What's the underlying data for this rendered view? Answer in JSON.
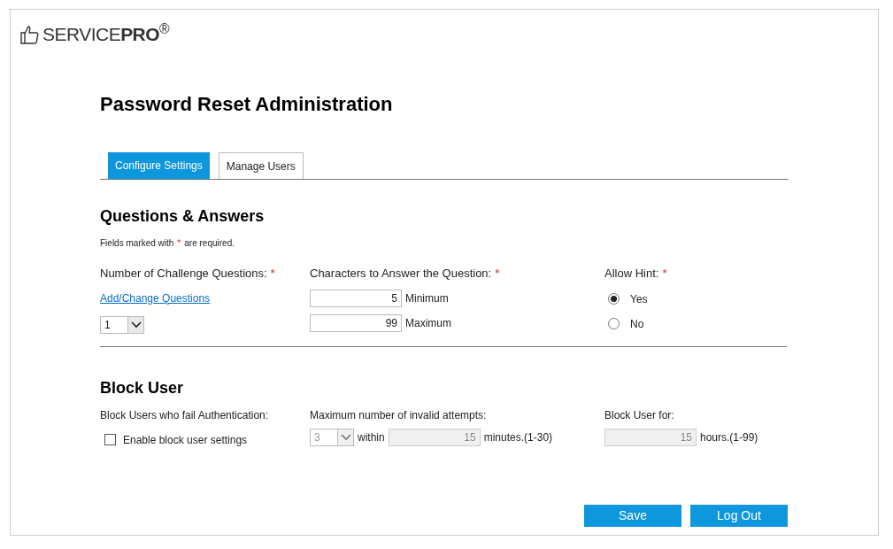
{
  "brand": {
    "text": "SERVICE**PRO**$^{®}$"
  },
  "title": "Password Reset Administration",
  "tabs": [
    {
      "label": "Configure Settings",
      "selected": true
    },
    {
      "label": "Manage Users",
      "selected": false
    }
  ],
  "questions": {
    "heading": "Questions & Answers",
    "note": {
      "before": "Fields marked with",
      "mark": "*",
      "after": "are required."
    },
    "count_label": {
      "text": "Number of Challenge Questions:",
      "mark": "*"
    },
    "link": "Add/Change Questions",
    "count_select": {
      "value": "1",
      "disabled": false
    },
    "chars_label": {
      "text": "Characters to Answer the Question:",
      "mark": "*"
    },
    "chars": [
      {
        "value": "5",
        "unit": "Minimum"
      },
      {
        "value": "99",
        "unit": "Maximum"
      }
    ],
    "hint_label": {
      "text": "Allow Hint:",
      "mark": "*"
    },
    "hint_options": [
      {
        "label": "Yes",
        "selected": true
      },
      {
        "label": "No",
        "selected": false
      }
    ]
  },
  "block": {
    "heading": "Block User",
    "fail_label": "Block Users who fail Authentication:",
    "enable": {
      "label": "Enable block user settings",
      "checked": false
    },
    "attempts_label": "Maximum number of invalid attempts:",
    "attempts_select": {
      "value": "3",
      "disabled": true
    },
    "within": "within",
    "minutes": {
      "value": "15",
      "disabled": true,
      "unit": "minutes.(1-30)"
    },
    "for_label": "Block User for:",
    "hours": {
      "value": "15",
      "disabled": true,
      "unit": "hours.(1-99)"
    }
  },
  "buttons": [
    "Save",
    "Log Out"
  ]
}
